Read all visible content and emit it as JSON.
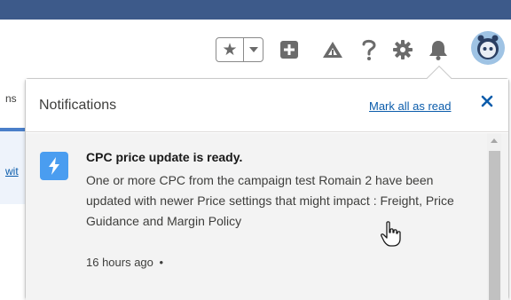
{
  "header": {
    "icons": [
      "favorites-star-icon",
      "chevron-down-icon",
      "add-icon",
      "trailhead-icon",
      "help-icon",
      "setup-gear-icon",
      "notifications-bell-icon",
      "avatar"
    ]
  },
  "background": {
    "left_text_1": "ns",
    "left_text_2": "wit"
  },
  "notifications": {
    "title": "Notifications",
    "mark_all_read": "Mark all as read",
    "items": [
      {
        "title": "CPC price update is ready.",
        "body": "One or more CPC from the campaign test Romain 2 have been updated with newer Price settings that might impact : Freight, Price Guidance and Margin Policy",
        "time": "16 hours ago",
        "unread_dot": "•"
      }
    ]
  },
  "colors": {
    "top_band": "#3d5a8a",
    "link": "#0b5cab",
    "notif_icon_bg": "#4a9df0",
    "icon_gray": "#6b6b6b"
  }
}
